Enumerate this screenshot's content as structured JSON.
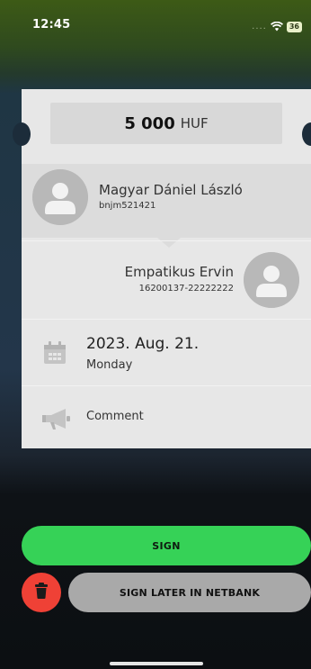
{
  "status_bar": {
    "time": "12:45",
    "signal": "....",
    "battery": "36"
  },
  "payment": {
    "amount": "5 000",
    "currency": "HUF",
    "sender": {
      "name": "Magyar Dániel László",
      "id": "bnjm521421"
    },
    "receiver": {
      "name": "Empatikus Ervin",
      "account": "16200137-22222222"
    },
    "date": {
      "date": "2023. Aug. 21.",
      "weekday": "Monday"
    },
    "comment_label": "Comment"
  },
  "actions": {
    "sign_label": "SIGN",
    "sign_later_label": "SIGN LATER IN NETBANK"
  },
  "colors": {
    "sign_button": "#36d257",
    "delete_button": "#ef4136",
    "later_button": "#a9a9a9",
    "card": "#e7e7e7"
  }
}
